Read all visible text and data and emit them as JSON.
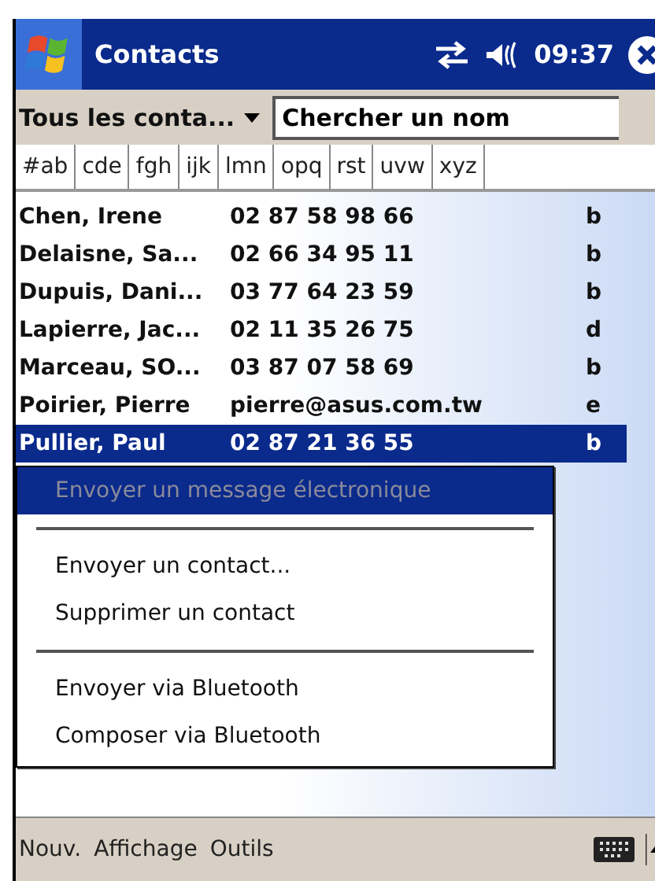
{
  "title_bar": {
    "title": "Contacts",
    "time": "09:37"
  },
  "toolbar": {
    "category": "Tous les conta...",
    "search": {
      "value": "Chercher un nom"
    }
  },
  "letter_tabs": [
    {
      "label": "#ab",
      "selected": false
    },
    {
      "label": "cde",
      "selected": false
    },
    {
      "label": "fgh",
      "selected": false
    },
    {
      "label": "ijk",
      "selected": false
    },
    {
      "label": "lmn",
      "selected": false
    },
    {
      "label": "opq",
      "selected": false
    },
    {
      "label": "rst",
      "selected": false
    },
    {
      "label": "uvw",
      "selected": false
    },
    {
      "label": "xyz",
      "selected": false
    }
  ],
  "contacts": [
    {
      "name": "Chen, Irene",
      "detail": "02 87 58 98 66",
      "type": "b",
      "selected": false
    },
    {
      "name": "Delaisne, Sa...",
      "detail": "02 66 34 95 11",
      "type": "b",
      "selected": false
    },
    {
      "name": "Dupuis, Dani...",
      "detail": "03 77 64 23 59",
      "type": "b",
      "selected": false
    },
    {
      "name": "Lapierre, Jac...",
      "detail": "02 11 35 26 75",
      "type": "d",
      "selected": false
    },
    {
      "name": "Marceau, SO...",
      "detail": "03 87 07 58 69",
      "type": "b",
      "selected": false
    },
    {
      "name": "Poirier, Pierre",
      "detail": "pierre@asus.com.tw",
      "type": "e",
      "selected": false
    },
    {
      "name": "Pullier, Paul",
      "detail": "02 87 21 36 55",
      "type": "b",
      "selected": true
    }
  ],
  "context_menu": [
    {
      "kind": "item",
      "label": "Envoyer un message électronique",
      "disabled": true,
      "selected": true
    },
    {
      "kind": "separator"
    },
    {
      "kind": "item",
      "label": "Envoyer un contact...",
      "disabled": false,
      "selected": false
    },
    {
      "kind": "item",
      "label": "Supprimer un contact",
      "disabled": false,
      "selected": false
    },
    {
      "kind": "separator"
    },
    {
      "kind": "item",
      "label": "Envoyer via Bluetooth",
      "disabled": false,
      "selected": false
    },
    {
      "kind": "item",
      "label": "Composer via Bluetooth",
      "disabled": false,
      "selected": false
    }
  ],
  "menu_bar": [
    "Nouv.",
    "Affichage",
    "Outils"
  ]
}
